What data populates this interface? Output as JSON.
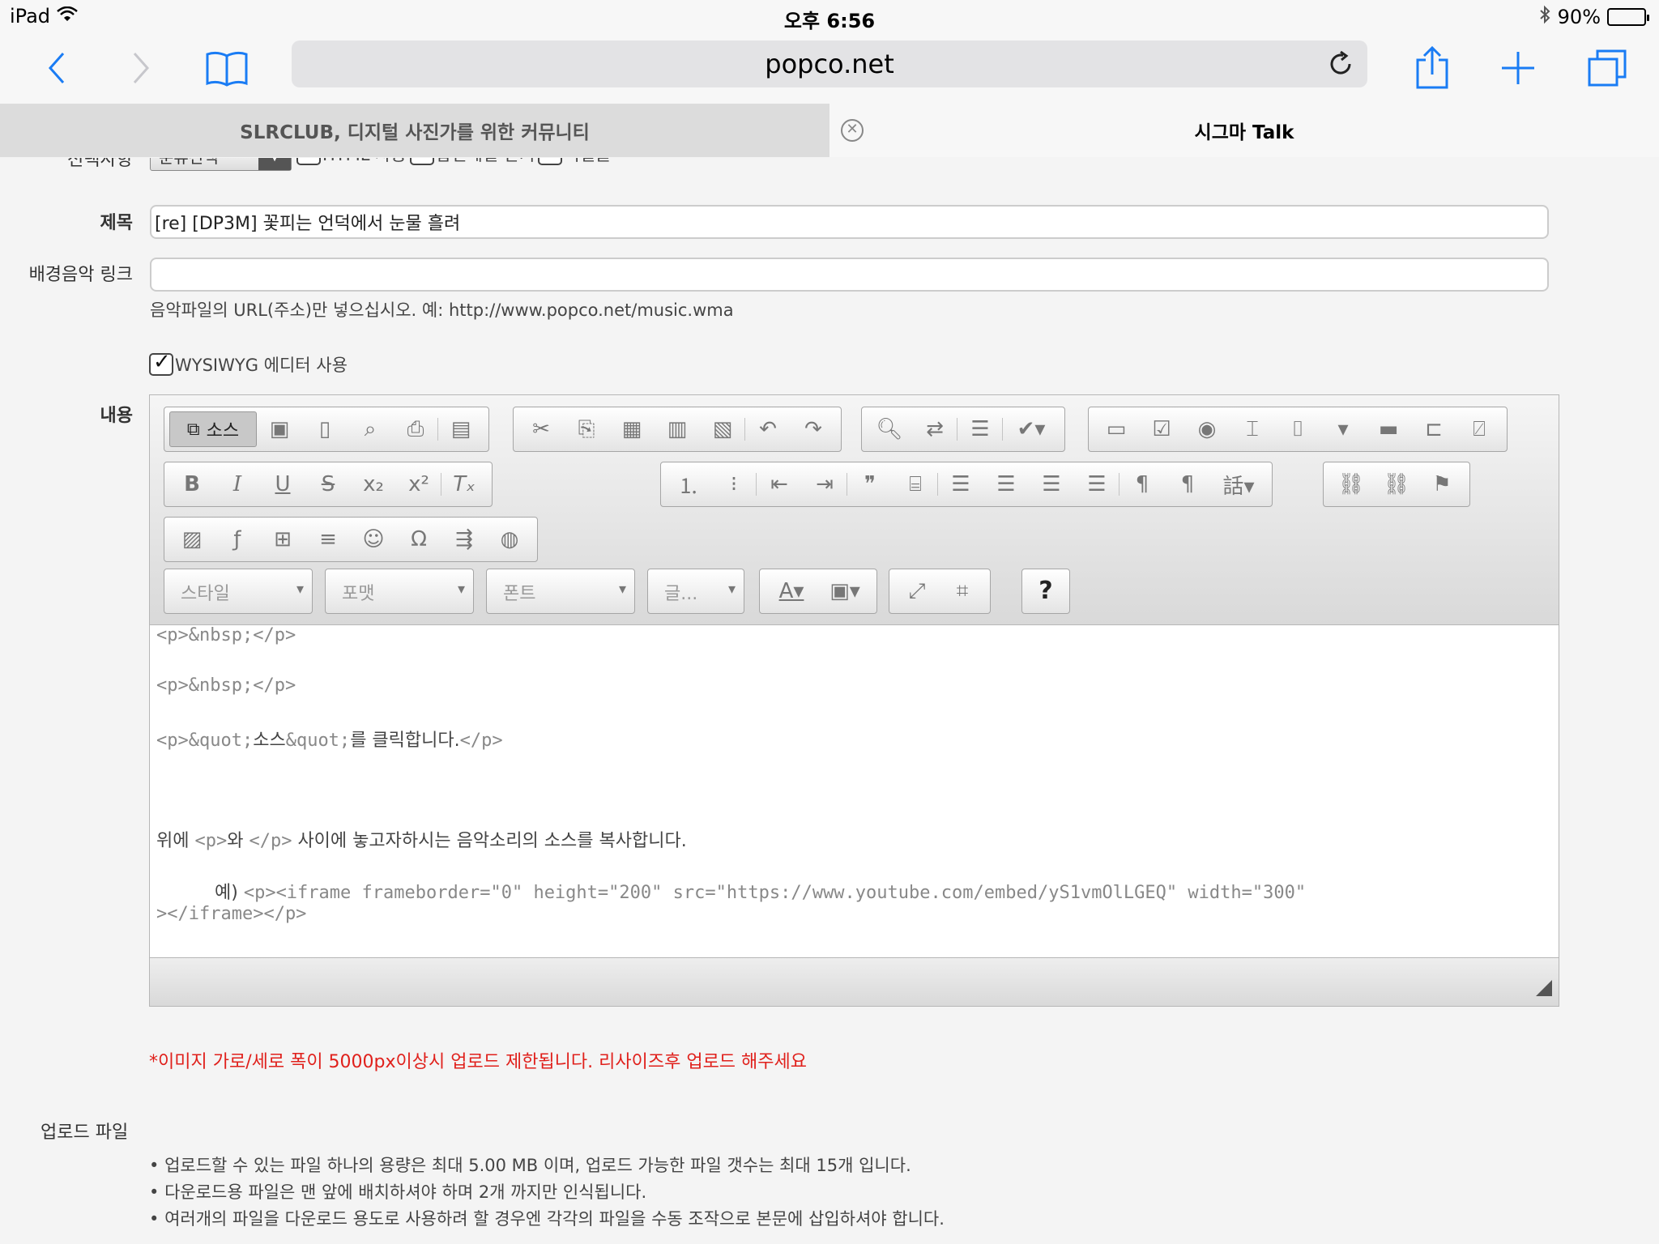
{
  "status": {
    "device": "iPad",
    "time": "오후 6:56",
    "battery": "90%",
    "battery_level": 0.9
  },
  "browser": {
    "url": "popco.net",
    "tabs": [
      {
        "label": "SLRCLUB, 디지털 사진가를 위한 커뮤니티"
      },
      {
        "label": "시그마 Talk"
      }
    ]
  },
  "form": {
    "options_label": "선택사항",
    "category_select": "분류선택",
    "option_html": "HTML 사용",
    "option_reply_mail": "답변메일 받기",
    "option_secret": "비밀글",
    "subject_label": "제목",
    "subject_value": "[re] [DP3M] 꽃피는 언덕에서 눈물 흘려",
    "bgm_label": "배경음악 링크",
    "bgm_value": "",
    "bgm_hint": "음악파일의 URL(주소)만 넣으십시오. 예: http://www.popco.net/music.wma",
    "wysiwyg_label": "WYSIWYG 에디터 사용",
    "content_label": "내용"
  },
  "editor": {
    "source_button": "소스",
    "combos": {
      "style": "스타일",
      "format": "포맷",
      "font": "폰트",
      "size": "글..."
    },
    "help": "?",
    "lines": {
      "l1": "<p>&nbsp;</p>",
      "l2": "<p>&nbsp;</p>",
      "l3a": "<p>&quot;",
      "l3b": "소스",
      "l3c": "&quot;",
      "l3d": "를 클릭합니다.",
      "l3e": "</p>",
      "l4a": "위에 ",
      "l4b": "<p>",
      "l4c": "와 ",
      "l4d": "</p>",
      "l4e": " 사이에 놓고자하시는 음악소리의 소스를 복사합니다.",
      "l5a": "예) ",
      "l5b": "<p><iframe frameborder=\"0\" height=\"200\" src=\"https://www.youtube.com/embed/yS1vmOlLGEQ\" width=\"300\"",
      "l6": "></iframe></p>"
    }
  },
  "warning": "*이미지 가로/세로 폭이 5000px이상시 업로드 제한됩니다. 리사이즈후 업로드 해주세요",
  "upload": {
    "label": "업로드 파일",
    "notes": [
      "업로드할 수 있는 파일 하나의 용량은 최대 5.00 MB 이며, 업로드 가능한 파일 갯수는 최대 15개 입니다.",
      "다운로드용 파일은 맨 앞에 배치하셔야 하며 2개 까지만 인식됩니다.",
      "여러개의 파일을 다운로드 용도로 사용하려 할 경우엔 각각의 파일을 수동 조작으로 본문에 삽입하셔야 합니다."
    ]
  },
  "colors": {
    "accent": "#1a7cf4",
    "warning": "#e0201b"
  }
}
